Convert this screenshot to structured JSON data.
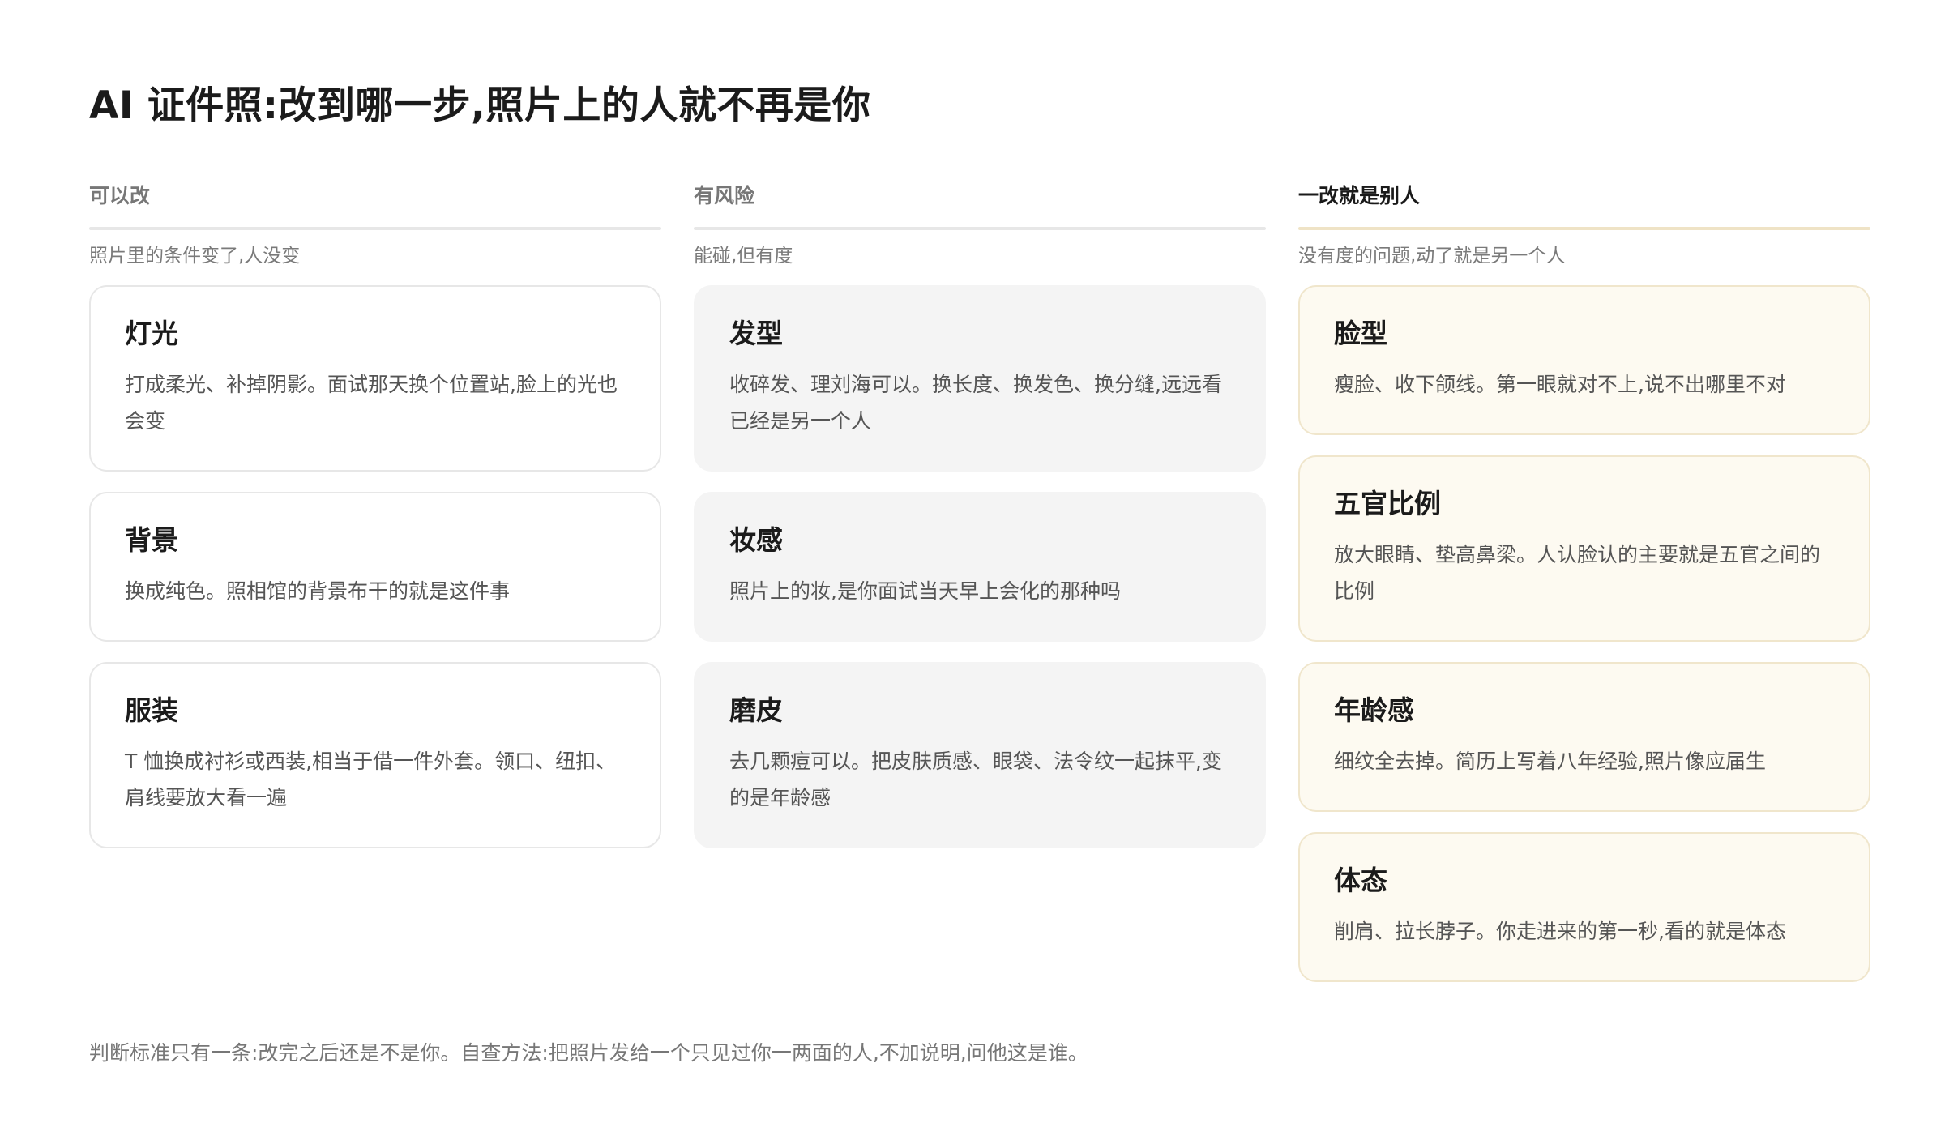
{
  "page": {
    "title": "AI 证件照:改到哪一步,照片上的人就不再是你",
    "footer": "判断标准只有一条:改完之后还是不是你。自查方法:把照片发给一个只见过你一两面的人,不加说明,问他这是谁。"
  },
  "columns": [
    {
      "header": "可以改",
      "subtitle": "照片里的条件变了,人没变",
      "cards": [
        {
          "title": "灯光",
          "text": "打成柔光、补掉阴影。面试那天换个位置站,脸上的光也会变"
        },
        {
          "title": "背景",
          "text": "换成纯色。照相馆的背景布干的就是这件事"
        },
        {
          "title": "服装",
          "text": "T 恤换成衬衫或西装,相当于借一件外套。领口、纽扣、肩线要放大看一遍"
        }
      ]
    },
    {
      "header": "有风险",
      "subtitle": "能碰,但有度",
      "cards": [
        {
          "title": "发型",
          "text": "收碎发、理刘海可以。换长度、换发色、换分缝,远远看已经是另一个人"
        },
        {
          "title": "妆感",
          "text": "照片上的妆,是你面试当天早上会化的那种吗"
        },
        {
          "title": "磨皮",
          "text": "去几颗痘可以。把皮肤质感、眼袋、法令纹一起抹平,变的是年龄感"
        }
      ]
    },
    {
      "header": "一改就是别人",
      "subtitle": "没有度的问题,动了就是另一个人",
      "cards": [
        {
          "title": "脸型",
          "text": "瘦脸、收下颌线。第一眼就对不上,说不出哪里不对"
        },
        {
          "title": "五官比例",
          "text": "放大眼睛、垫高鼻梁。人认脸认的主要就是五官之间的比例"
        },
        {
          "title": "年龄感",
          "text": "细纹全去掉。简历上写着八年经验,照片像应届生"
        },
        {
          "title": "体态",
          "text": "削肩、拉长脖子。你走进来的第一秒,看的就是体态"
        }
      ]
    }
  ]
}
